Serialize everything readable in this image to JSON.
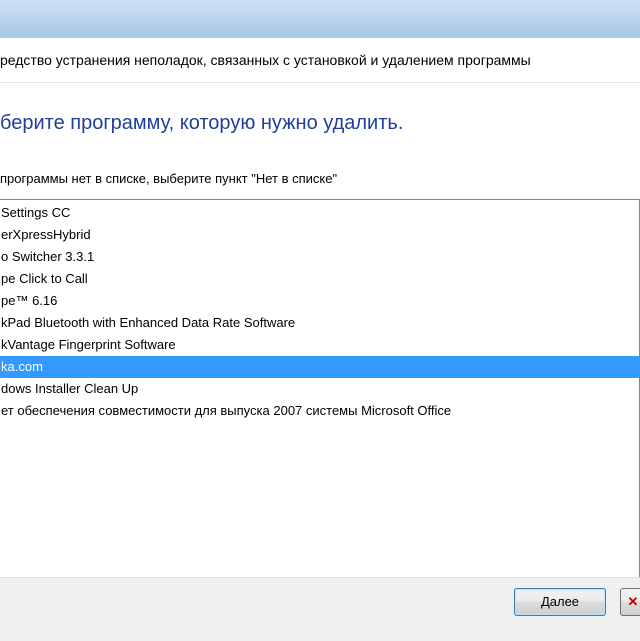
{
  "header": {
    "title": "редство устранения неполадок, связанных с установкой и удалением программы"
  },
  "main": {
    "instruction": "берите программу, которую нужно удалить.",
    "hint": "программы нет в списке, выберите пункт \"Нет в списке\""
  },
  "programs": {
    "items": [
      "Settings CC",
      "erXpressHybrid",
      "o Switcher 3.3.1",
      "pe Click to Call",
      "pe™ 6.16",
      "kPad Bluetooth with Enhanced Data Rate Software",
      "kVantage Fingerprint Software",
      "ka.com",
      "dows Installer Clean Up",
      "ет обеспечения совместимости для выпуска 2007 системы Microsoft Office"
    ],
    "selected_index": 7
  },
  "footer": {
    "next_label": "Далее",
    "cancel_icon": "close-icon"
  }
}
